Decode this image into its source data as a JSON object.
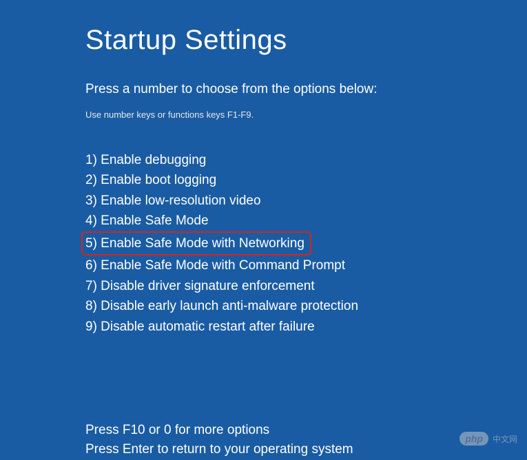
{
  "title": "Startup Settings",
  "subtitle": "Press a number to choose from the options below:",
  "hint": "Use number keys or functions keys F1-F9.",
  "options": [
    {
      "label": "1) Enable debugging",
      "highlighted": false
    },
    {
      "label": "2) Enable boot logging",
      "highlighted": false
    },
    {
      "label": "3) Enable low-resolution video",
      "highlighted": false
    },
    {
      "label": "4) Enable Safe Mode",
      "highlighted": false
    },
    {
      "label": "5) Enable Safe Mode with Networking",
      "highlighted": true
    },
    {
      "label": "6) Enable Safe Mode with Command Prompt",
      "highlighted": false
    },
    {
      "label": "7) Disable driver signature enforcement",
      "highlighted": false
    },
    {
      "label": "8) Disable early launch anti-malware protection",
      "highlighted": false
    },
    {
      "label": "9) Disable automatic restart after failure",
      "highlighted": false
    }
  ],
  "footer": {
    "line1": "Press F10 or 0 for more options",
    "line2": "Press Enter to return to your operating system"
  },
  "watermark": {
    "badge": "php",
    "text": "中文网"
  }
}
